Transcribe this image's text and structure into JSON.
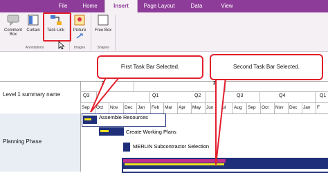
{
  "ribbon": {
    "tabs": [
      "File",
      "Home",
      "Insert",
      "Page Layout",
      "Data",
      "View"
    ],
    "active_tab": "Insert",
    "buttons": {
      "comment_box": "Comment Box",
      "curtain": "Curtain",
      "task_link": "Task Link",
      "picture": "Picture",
      "free_box": "Free Box"
    },
    "groups": [
      "Annotations",
      "Images",
      "Shapes"
    ]
  },
  "callouts": {
    "first": "First Task Bar Selected.",
    "second": "Second Task Bar Selected."
  },
  "timeline": {
    "years": [
      "2",
      "20"
    ],
    "quarters": [
      "Q3",
      "Q4",
      "Q1",
      "Q2",
      "Q3",
      "Q4",
      "Q1"
    ],
    "months": [
      "Sep",
      "Oct",
      "Nov",
      "Dec",
      "Jan",
      "Feb",
      "Mar",
      "Apr",
      "May",
      "Jun",
      "Jul",
      "Aug",
      "Sep",
      "Oct",
      "Nov",
      "Dec",
      "Jan",
      "F"
    ]
  },
  "rows": {
    "level1": "Level 1 summary name",
    "phase": "Planning Phase"
  },
  "tasks": [
    "Assemble Resources",
    "Create Working Plans",
    "MERLIN Subcontractor Selection"
  ],
  "colors": {
    "ribbon_purple": "#8e3c99",
    "highlight_red": "#e21f2b",
    "bar_navy": "#1f2f7a",
    "bar_yellow": "#f2e21c",
    "bar_magenta": "#c22f8e"
  }
}
